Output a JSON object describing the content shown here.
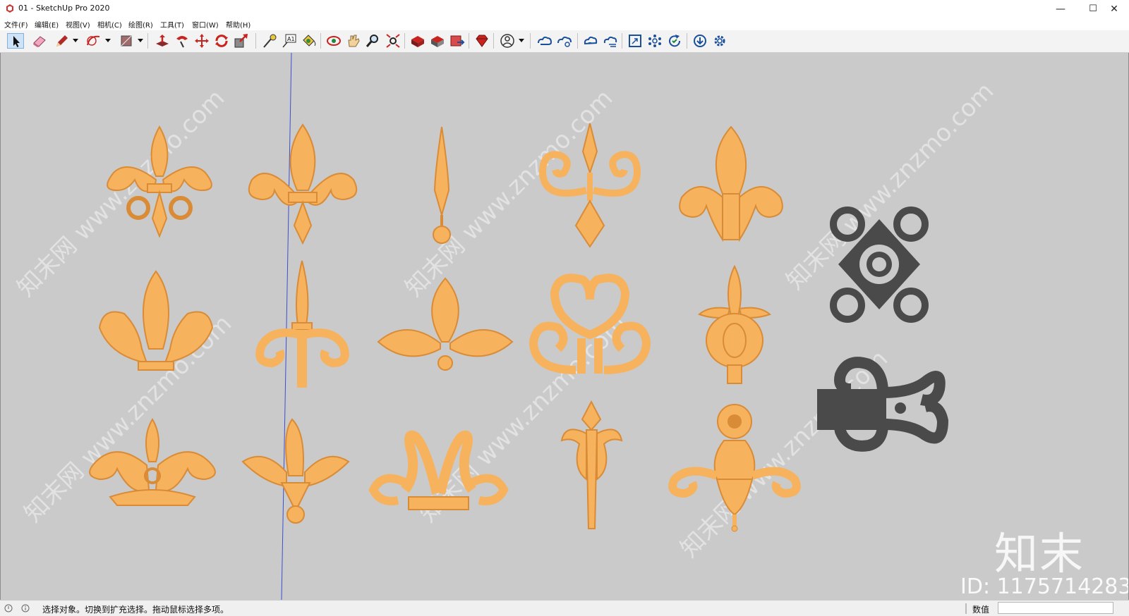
{
  "window": {
    "title": "01 - SketchUp Pro 2020",
    "controls": {
      "minimize": "—",
      "maximize": "☐",
      "close": "✕"
    }
  },
  "menu": {
    "items": [
      {
        "label": "文件(F)"
      },
      {
        "label": "编辑(E)"
      },
      {
        "label": "视图(V)"
      },
      {
        "label": "相机(C)"
      },
      {
        "label": "绘图(R)"
      },
      {
        "label": "工具(T)"
      },
      {
        "label": "窗口(W)"
      },
      {
        "label": "帮助(H)"
      }
    ]
  },
  "toolbar": {
    "tools": [
      "select-icon",
      "eraser-icon",
      "pencil-icon",
      "arc-icon",
      "rectangle-icon",
      "push-pull-icon",
      "follow-me-icon",
      "move-icon",
      "rotate-icon",
      "scale-icon",
      "tape-measure-icon",
      "text-icon",
      "paint-bucket-icon",
      "orbit-icon",
      "pan-icon",
      "zoom-icon",
      "zoom-extents-icon",
      "warehouse-icon",
      "extension-warehouse-icon",
      "send-to-layout-icon",
      "extension-manager-icon",
      "account-icon",
      "trimble-connect-icon",
      "trimble-share-icon",
      "cloud-upload-icon",
      "cloud-sync-icon",
      "section-icon",
      "nodes-icon",
      "refresh-icon",
      "download-icon",
      "settings-icon"
    ],
    "colors": {
      "accent": "#1a4f9c",
      "red": "#c8231f",
      "active": "#cfe3f8"
    }
  },
  "viewport": {
    "background": "#cacaca",
    "ornament_color": "#f7b25e",
    "ornament_shade": "#d98b35",
    "dark_ornament_color": "#4a4a4a",
    "watermark": "知末网 www.znzmo.com",
    "brand": "知末",
    "id_text": "ID: 1175714283"
  },
  "status": {
    "hint": "选择对象。切换到扩充选择。拖动鼠标选择多项。",
    "measure_label": "数值",
    "measure_value": ""
  }
}
